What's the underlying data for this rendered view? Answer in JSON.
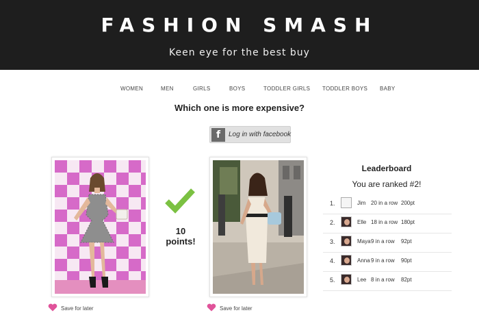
{
  "header": {
    "brand": "FASHION SMASH",
    "tagline": "Keen eye for the best buy"
  },
  "nav": {
    "items": [
      "WOMEN",
      "MEN",
      "GIRLS",
      "BOYS",
      "TODDLER GIRLS",
      "TODDLER BOYS",
      "BABY"
    ]
  },
  "game": {
    "question": "Which one is more expensive?",
    "facebook_button": "Log in with facebook",
    "facebook_glyph": "f",
    "result_points": "10",
    "result_suffix": "points!",
    "save_label": "Save for later"
  },
  "leaderboard": {
    "title": "Leaderboard",
    "rank_text": "You are ranked #2!",
    "entries": [
      {
        "rank": "1.",
        "name": "Jim",
        "streak": "20 in a row",
        "points": "200pt"
      },
      {
        "rank": "2.",
        "name": "Elle",
        "streak": "18 in a row",
        "points": "180pt"
      },
      {
        "rank": "3.",
        "name": "Maya",
        "streak": "9 in a row",
        "points": "92pt"
      },
      {
        "rank": "4.",
        "name": "Anna",
        "streak": "9 in a row",
        "points": "90pt"
      },
      {
        "rank": "5.",
        "name": "Lee",
        "streak": "8 in a row",
        "points": "82pt"
      }
    ]
  },
  "colors": {
    "header_bg": "#1e1e1e",
    "check_green": "#7bc142",
    "heart_pink": "#e0539a",
    "backdrop_pink": "#d66ac8"
  }
}
